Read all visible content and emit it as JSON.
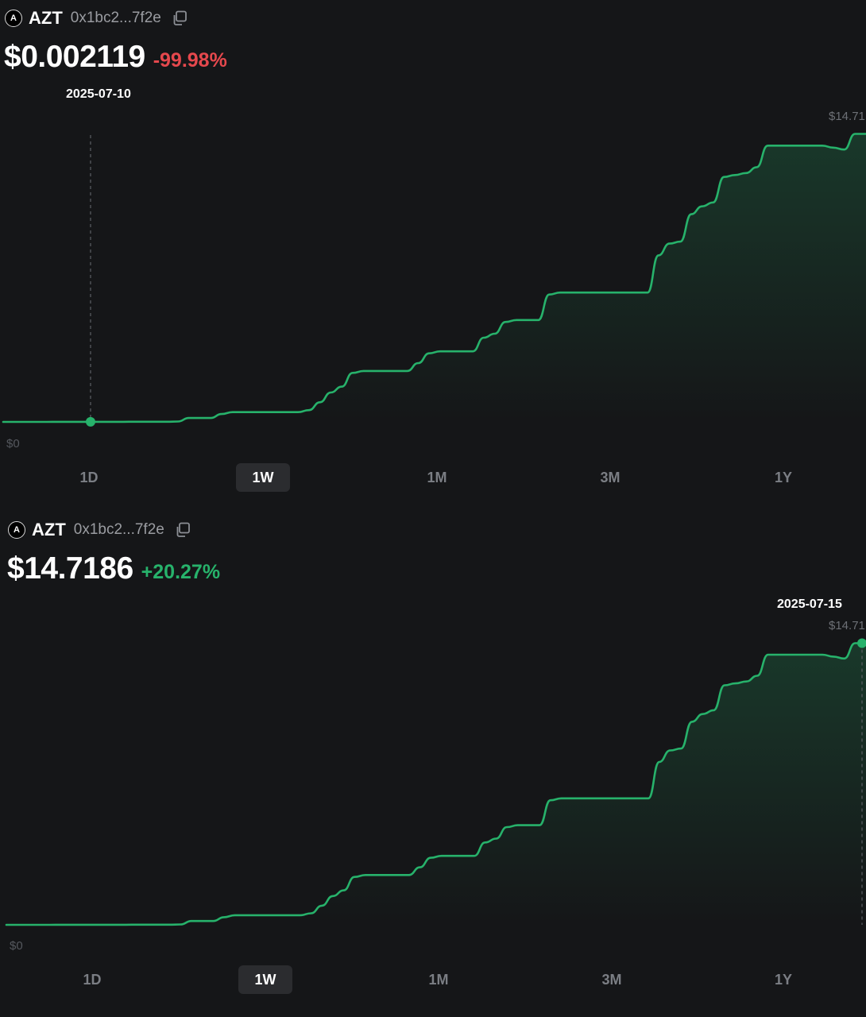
{
  "panels": [
    {
      "token": {
        "symbol": "AZT",
        "address": "0x1bc2...7f2e",
        "logo_letter": "A"
      },
      "price": "$0.002119",
      "change": "-99.98%",
      "change_dir": "down",
      "hover_date": "2025-07-10",
      "max_label": "$14.71",
      "zero_label": "$0",
      "ranges": [
        "1D",
        "1W",
        "1M",
        "3M",
        "1Y"
      ],
      "selected_range": "1W"
    },
    {
      "token": {
        "symbol": "AZT",
        "address": "0x1bc2...7f2e",
        "logo_letter": "A"
      },
      "price": "$14.7186",
      "change": "+20.27%",
      "change_dir": "up",
      "hover_date": "2025-07-15",
      "max_label": "$14.71",
      "zero_label": "$0",
      "ranges": [
        "1D",
        "1W",
        "1M",
        "3M",
        "1Y"
      ],
      "selected_range": "1W"
    }
  ],
  "colors": {
    "line": "#27b26b",
    "negative": "#e5484d",
    "positive": "#27b26b",
    "background": "#151618"
  },
  "chart_data": {
    "type": "line",
    "x_range": [
      "2025-07-08",
      "2025-07-15"
    ],
    "ylim": [
      0,
      14.72
    ],
    "values": [
      0.002,
      0.002,
      0.002,
      0.002,
      0.002,
      0.003,
      0.003,
      0.003,
      0.004,
      0.004,
      0.004,
      0.006,
      0.007,
      0.008,
      0.009,
      0.01,
      0.02,
      0.2,
      0.2,
      0.2,
      0.4,
      0.5,
      0.5,
      0.5,
      0.5,
      0.5,
      0.5,
      0.5,
      0.6,
      1.0,
      1.5,
      1.8,
      2.5,
      2.6,
      2.6,
      2.6,
      2.6,
      2.6,
      3.0,
      3.5,
      3.6,
      3.6,
      3.6,
      3.6,
      4.3,
      4.5,
      5.1,
      5.2,
      5.2,
      5.2,
      6.5,
      6.6,
      6.6,
      6.6,
      6.6,
      6.6,
      6.6,
      6.6,
      6.6,
      6.6,
      8.5,
      9.1,
      9.2,
      10.6,
      11.0,
      11.2,
      12.5,
      12.6,
      12.7,
      13.0,
      14.1,
      14.1,
      14.1,
      14.1,
      14.1,
      14.1,
      14.0,
      13.9,
      14.7,
      14.7
    ]
  }
}
